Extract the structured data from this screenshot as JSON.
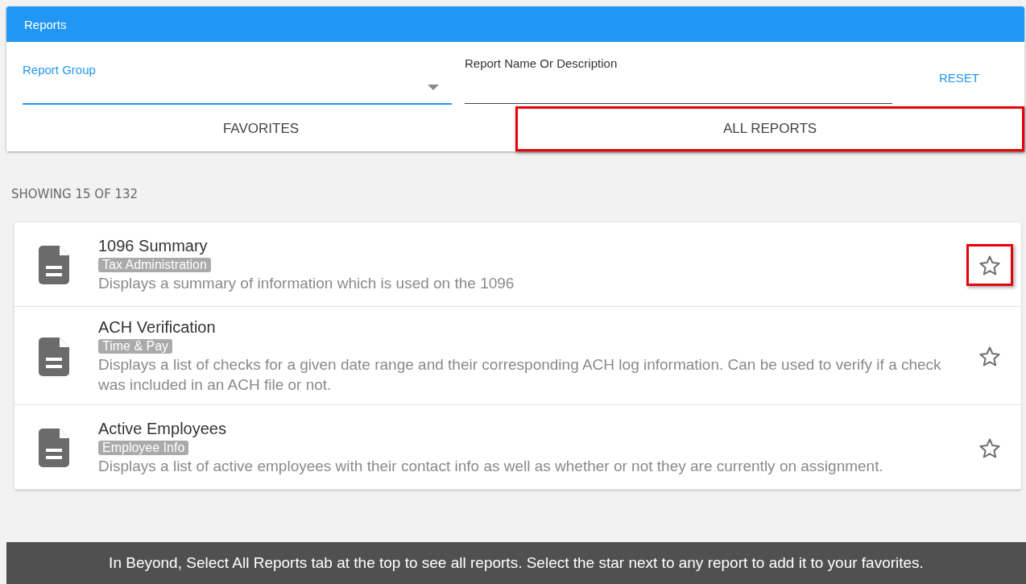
{
  "header": {
    "title": "Reports"
  },
  "filters": {
    "group": {
      "label": "Report Group",
      "focused": true
    },
    "search": {
      "label": "Report Name Or Description"
    },
    "reset": "RESET"
  },
  "tabs": [
    {
      "label": "FAVORITES",
      "highlighted": false
    },
    {
      "label": "ALL REPORTS",
      "highlighted": true
    }
  ],
  "count": "SHOWING 15 OF 132",
  "reports": [
    {
      "name": "1096 Summary",
      "category": "Tax Administration",
      "description": "Displays a summary of information which is used on the 1096",
      "favorite": false,
      "highlighted": true
    },
    {
      "name": "ACH Verification",
      "category": "Time & Pay",
      "description": "Displays a list of checks for a given date range and their corresponding ACH log information. Can be used to verify if a check was included in an ACH file or not.",
      "favorite": false,
      "highlighted": false
    },
    {
      "name": "Active Employees",
      "category": "Employee Info",
      "description": "Displays a list of active employees with their contact info as well as whether or not they are currently on assignment.",
      "favorite": false,
      "highlighted": false
    }
  ],
  "caption": "In Beyond, Select All Reports tab at the top to see all reports. Select the star next to any report to add it to your favorites."
}
